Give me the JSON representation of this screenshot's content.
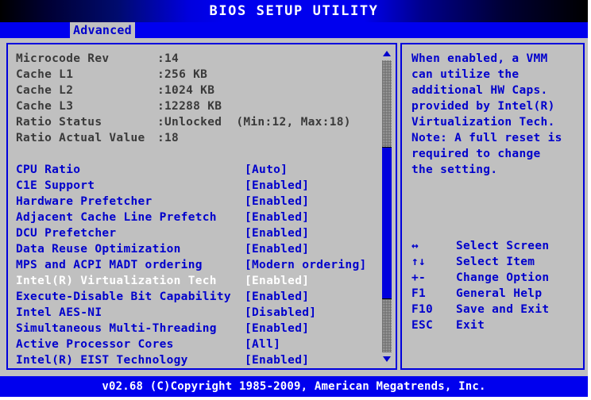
{
  "titlebar": {
    "title": "BIOS SETUP UTILITY"
  },
  "menubar": {
    "active_tab": "Advanced"
  },
  "info": {
    "rows": [
      {
        "label": "Microcode Rev",
        "value": ":14"
      },
      {
        "label": "Cache L1",
        "value": ":256 KB"
      },
      {
        "label": "Cache L2",
        "value": ":1024 KB"
      },
      {
        "label": "Cache L3",
        "value": ":12288 KB"
      },
      {
        "label": "Ratio Status",
        "value": ":Unlocked  (Min:12, Max:18)"
      },
      {
        "label": "Ratio Actual Value",
        "value": ":18"
      }
    ]
  },
  "settings": {
    "rows": [
      {
        "label": "CPU Ratio",
        "value": "[Auto]",
        "selected": false
      },
      {
        "label": "C1E Support",
        "value": "[Enabled]",
        "selected": false
      },
      {
        "label": "Hardware Prefetcher",
        "value": "[Enabled]",
        "selected": false
      },
      {
        "label": "Adjacent Cache Line Prefetch",
        "value": "[Enabled]",
        "selected": false
      },
      {
        "label": "DCU Prefetcher",
        "value": "[Enabled]",
        "selected": false
      },
      {
        "label": "Data Reuse Optimization",
        "value": "[Enabled]",
        "selected": false
      },
      {
        "label": "MPS and ACPI MADT ordering",
        "value": "[Modern ordering]",
        "selected": false
      },
      {
        "label": "Intel(R) Virtualization Tech",
        "value": "[Enabled]",
        "selected": true
      },
      {
        "label": "Execute-Disable Bit Capability",
        "value": "[Enabled]",
        "selected": false
      },
      {
        "label": "Intel AES-NI",
        "value": "[Disabled]",
        "selected": false
      },
      {
        "label": "Simultaneous Multi-Threading",
        "value": "[Enabled]",
        "selected": false
      },
      {
        "label": "Active Processor Cores",
        "value": "[All]",
        "selected": false
      },
      {
        "label": "Intel(R) EIST Technology",
        "value": "[Enabled]",
        "selected": false
      }
    ]
  },
  "scrollbar": {
    "up_arrow_icon": "triangle-up-icon",
    "down_arrow_icon": "triangle-down-icon"
  },
  "help": {
    "lines": [
      "When enabled, a VMM",
      "can utilize the",
      "additional HW Caps.",
      "provided by Intel(R)",
      "Virtualization Tech.",
      "Note: A full reset is",
      "required to change",
      "the setting."
    ]
  },
  "legend": {
    "rows": [
      {
        "key": "↔",
        "desc": "Select Screen"
      },
      {
        "key": "↑↓",
        "desc": "Select Item"
      },
      {
        "key": "+-",
        "desc": "Change Option"
      },
      {
        "key": "F1",
        "desc": "General Help"
      },
      {
        "key": "F10",
        "desc": "Save and Exit"
      },
      {
        "key": "ESC",
        "desc": "Exit"
      }
    ]
  },
  "footer": {
    "text": "v02.68 (C)Copyright 1985-2009, American Megatrends, Inc."
  },
  "colors": {
    "panel_bg": "#c0c0c0",
    "accent_blue": "#0000cc",
    "bar_blue": "#0000ee",
    "selected_text": "#ffffff",
    "info_text": "#3a3a3a"
  }
}
